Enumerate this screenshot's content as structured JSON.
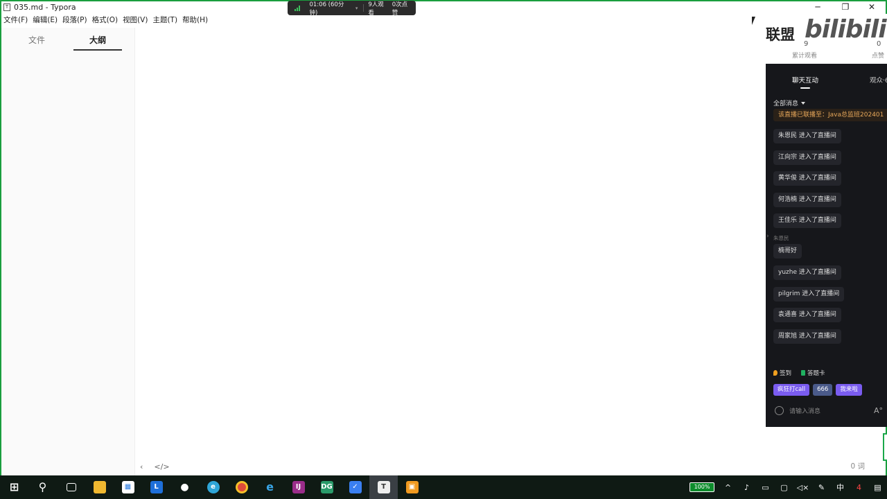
{
  "window": {
    "title": "035.md - Typora",
    "app_icon": "T",
    "minimize": "─",
    "maximize": "❐",
    "close": "✕"
  },
  "menu": [
    "文件(F)",
    "编辑(E)",
    "段落(P)",
    "格式(O)",
    "视图(V)",
    "主题(T)",
    "帮助(H)"
  ],
  "sidebar": {
    "tab_file": "文件",
    "tab_outline": "大纲"
  },
  "editor": {
    "footer_left": "‹",
    "footer_code": "</>",
    "word_count": "0 词"
  },
  "live_pill": {
    "time": "01:06 (60分钟)",
    "caret": "▾",
    "viewers": "9人观看",
    "likes": "0次点赞"
  },
  "live_panel": {
    "league": "联盟",
    "logo": "bilibili",
    "views_value": "9",
    "views_label": "累计观看",
    "likes_value": "0",
    "likes_label": "点赞",
    "tab_chat": "聊天互动",
    "tab_audience": "观众·6",
    "filter": "全部消息",
    "notice": "该直播已联播至：Java总监班202401",
    "messages": [
      "朱恩民 进入了直播间",
      "江向宗 进入了直播间",
      "黄华俊 进入了直播间",
      "何浩楠 进入了直播间",
      "王佳乐 进入了直播间",
      "楠哥好",
      "yuzhe 进入了直播间",
      "pilgrim 进入了直播间",
      "袁通喜 进入了直播间",
      "周家旭 进入了直播间"
    ],
    "sender_label": "朱恩民",
    "quick_checkin": "签到",
    "quick_card": "答题卡",
    "btn_call": "疯狂打call",
    "btn_666": "666",
    "btn_come": "我来啦",
    "input_placeholder": "请输入消息",
    "font_button": "A°"
  },
  "taskbar": {
    "battery": "100%",
    "ime": "中",
    "notification_badge": "4"
  }
}
